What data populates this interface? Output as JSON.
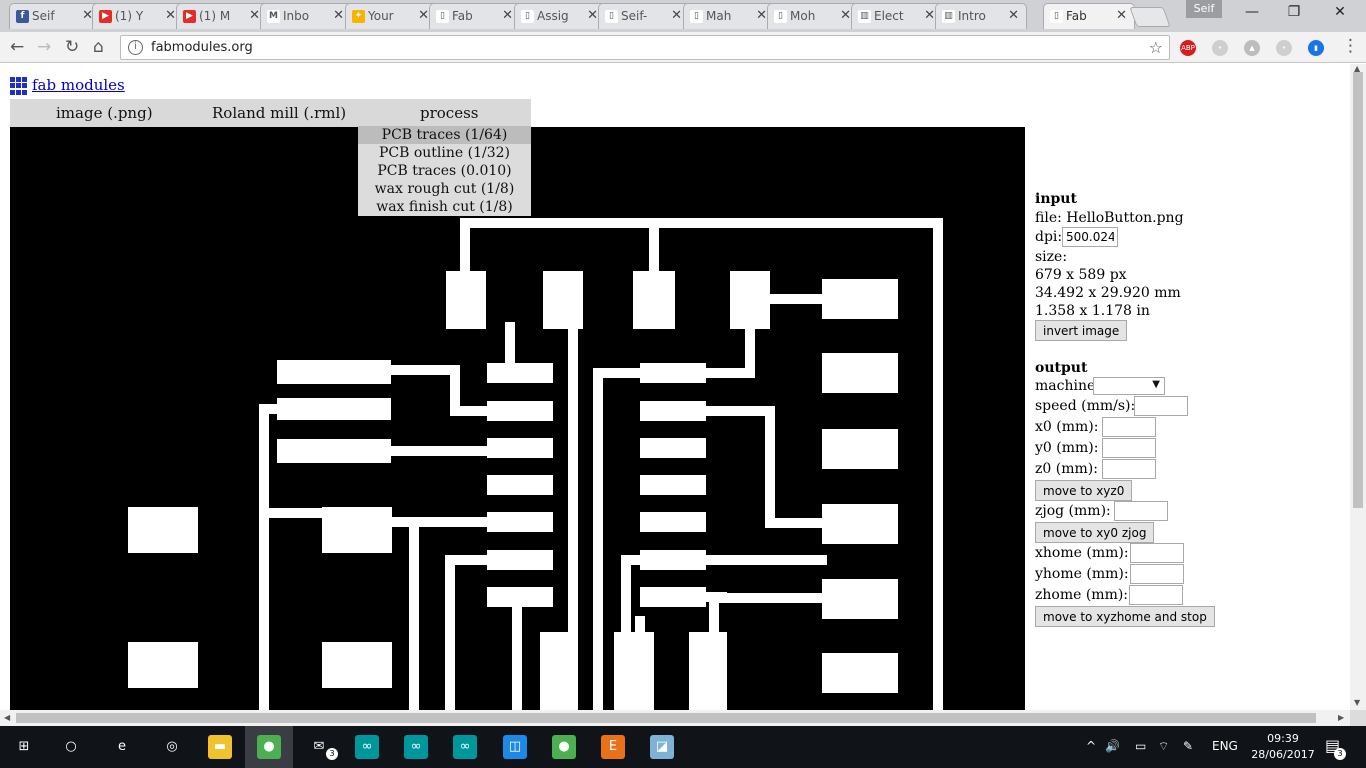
{
  "browser": {
    "tabs": [
      {
        "label": "Seif",
        "icon": "facebook-icon",
        "color": "#3b5998",
        "glyph": "f"
      },
      {
        "label": "(1) Y",
        "icon": "youtube-icon",
        "color": "#e52d27",
        "glyph": "▶"
      },
      {
        "label": "(1) M",
        "icon": "youtube-icon",
        "color": "#e52d27",
        "glyph": "▶"
      },
      {
        "label": "Inbo",
        "icon": "gmail-icon",
        "color": "#ffffff",
        "glyph": "M"
      },
      {
        "label": "Your",
        "icon": "handshake-icon",
        "color": "#f5b400",
        "glyph": "✦"
      },
      {
        "label": "Fab",
        "icon": "page-icon",
        "color": "#ffffff",
        "glyph": "▯"
      },
      {
        "label": "Assig",
        "icon": "page-icon",
        "color": "#ffffff",
        "glyph": "▯"
      },
      {
        "label": "Seif-",
        "icon": "page-icon",
        "color": "#ffffff",
        "glyph": "▯"
      },
      {
        "label": "Mah",
        "icon": "page-icon",
        "color": "#ffffff",
        "glyph": "▯"
      },
      {
        "label": "Moh",
        "icon": "page-icon",
        "color": "#ffffff",
        "glyph": "▯"
      },
      {
        "label": "Elect",
        "icon": "book-icon",
        "color": "#ffffff",
        "glyph": "▥"
      },
      {
        "label": "Intro",
        "icon": "book-icon",
        "color": "#ffffff",
        "glyph": "▥"
      },
      {
        "label": "Fab",
        "icon": "page-icon",
        "color": "#ffffff",
        "glyph": "▯"
      }
    ],
    "close_glyph": "✕",
    "user": "Seif",
    "window_controls": {
      "minimize": "—",
      "restore": "❐",
      "close": "✕"
    },
    "nav": {
      "back": "←",
      "forward": "→",
      "reload": "↻",
      "home": "⌂"
    },
    "url": "fabmodules.org",
    "star": "☆",
    "extensions": [
      {
        "name": "adblock-plus-icon",
        "color": "#d71e1e",
        "glyph": "ABP"
      },
      {
        "name": "extension-icon-2",
        "color": "#cfcfcf",
        "glyph": "•"
      },
      {
        "name": "drive-icon",
        "color": "#bdbdbd",
        "glyph": "▲"
      },
      {
        "name": "extension-icon-4",
        "color": "#cfcfcf",
        "glyph": "•"
      },
      {
        "name": "bookmark-ext-icon",
        "color": "#1a73e8",
        "glyph": "▮"
      }
    ],
    "menu_glyph": "⋮"
  },
  "page": {
    "title": "fab modules",
    "menu": {
      "input": "image (.png)",
      "output": "Roland mill (.rml)",
      "process": "process"
    },
    "process_options": [
      "PCB traces (1/64)",
      "PCB outline (1/32)",
      "PCB traces (0.010)",
      "wax rough cut (1/8)",
      "wax finish cut (1/8)"
    ],
    "selected_option_index": 0
  },
  "panel": {
    "input_heading": "input",
    "file": "file: HelloButton.png",
    "dpi_label": "dpi:",
    "dpi_value": "500.024",
    "size_label": "size:",
    "size_px": "679 x 589 px",
    "size_mm": "34.492 x 29.920 mm",
    "size_in": "1.358 x 1.178 in",
    "invert_button": "invert image",
    "output_heading": "output",
    "machine_label": "machine",
    "speed_label": "speed (mm/s):",
    "x0_label": "x0 (mm):",
    "y0_label": "y0 (mm):",
    "z0_label": "z0 (mm):",
    "move_xyz0_button": "move to xyz0",
    "zjog_label": "zjog (mm):",
    "move_xy0_button": "move to xy0 zjog",
    "xhome_label": "xhome (mm):",
    "yhome_label": "yhome (mm):",
    "zhome_label": "zhome (mm):",
    "move_home_button": "move to xyzhome and stop"
  },
  "taskbar": {
    "apps": [
      {
        "name": "windows-start-icon",
        "glyph": "⊞",
        "color": "#101419"
      },
      {
        "name": "cortana-icon",
        "glyph": "○",
        "color": "#101419"
      },
      {
        "name": "edge-icon",
        "glyph": "e",
        "color": "#101419"
      },
      {
        "name": "groove-icon",
        "glyph": "◎",
        "color": "#101419"
      },
      {
        "name": "file-explorer-icon",
        "glyph": "▬",
        "color": "#f2c12e"
      },
      {
        "name": "chrome-icon",
        "glyph": "●",
        "color": "#4caf50"
      },
      {
        "name": "mail-icon",
        "glyph": "✉",
        "color": "#101419"
      },
      {
        "name": "arduino-icon",
        "glyph": "∞",
        "color": "#00979c"
      },
      {
        "name": "arduino-icon",
        "glyph": "∞",
        "color": "#00979c"
      },
      {
        "name": "arduino-icon",
        "glyph": "∞",
        "color": "#00979c"
      },
      {
        "name": "app-icon",
        "glyph": "◫",
        "color": "#1e88e5"
      },
      {
        "name": "chrome-icon",
        "glyph": "●",
        "color": "#4caf50"
      },
      {
        "name": "eagle-icon",
        "glyph": "E",
        "color": "#e8711a"
      },
      {
        "name": "app-icon-2",
        "glyph": "◪",
        "color": "#7fb3d5"
      }
    ],
    "mail_badge": "3",
    "tray": {
      "chevron": "^",
      "volume": "🔊",
      "wifi": "⌔",
      "pen": "✎",
      "language": "ENG"
    },
    "time": "09:39",
    "date": "28/06/2017",
    "notification_count": "3"
  }
}
